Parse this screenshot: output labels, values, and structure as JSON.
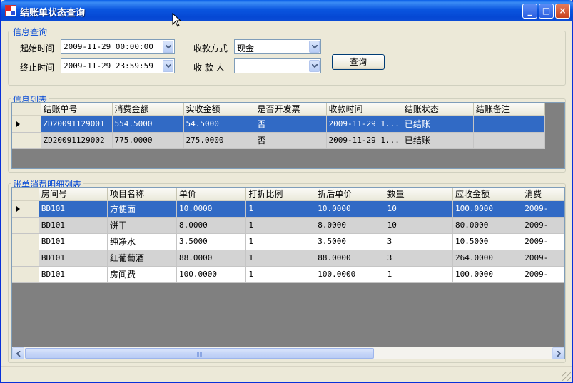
{
  "window": {
    "title": "结账单状态查询",
    "controls": {
      "minimize": "_",
      "maximize": "□",
      "close": "×"
    }
  },
  "query": {
    "legend": "信息查询",
    "start_label": "起始时间",
    "start_value": "2009-11-29 00:00:00",
    "end_label": "终止时间",
    "end_value": "2009-11-29 23:59:59",
    "payment_label": "收款方式",
    "payment_value": "现金",
    "payee_label": "收 款 人",
    "payee_value": "",
    "search_button": "查询"
  },
  "info": {
    "legend": "信息列表",
    "columns": [
      "结账单号",
      "消费金额",
      "实收金额",
      "是否开发票",
      "收款时间",
      "结账状态",
      "结账备注"
    ],
    "rows": [
      [
        "ZD20091129001",
        "554.5000",
        "54.5000",
        "否",
        "2009-11-29 1...",
        "已结账",
        ""
      ],
      [
        "ZD20091129002",
        "775.0000",
        "275.0000",
        "否",
        "2009-11-29 1...",
        "已结账",
        ""
      ]
    ]
  },
  "detail": {
    "legend": "账单消费明细列表",
    "columns": [
      "房间号",
      "项目名称",
      "单价",
      "打折比例",
      "折后单价",
      "数量",
      "应收金额",
      "消费"
    ],
    "rows": [
      [
        "BD101",
        "方便面",
        "10.0000",
        "1",
        "10.0000",
        "10",
        "100.0000",
        "2009-"
      ],
      [
        "BD101",
        "饼干",
        "8.0000",
        "1",
        "8.0000",
        "10",
        "80.0000",
        "2009-"
      ],
      [
        "BD101",
        "纯净水",
        "3.5000",
        "1",
        "3.5000",
        "3",
        "10.5000",
        "2009-"
      ],
      [
        "BD101",
        "红葡萄酒",
        "88.0000",
        "1",
        "88.0000",
        "3",
        "264.0000",
        "2009-"
      ],
      [
        "BD101",
        "房间费",
        "100.0000",
        "1",
        "100.0000",
        "1",
        "100.0000",
        "2009-"
      ]
    ],
    "hscroll_position": 0.0
  },
  "colors": {
    "selection": "#316ac5",
    "alt_row": "#d3d3d3",
    "legend_text": "#0046d5"
  }
}
